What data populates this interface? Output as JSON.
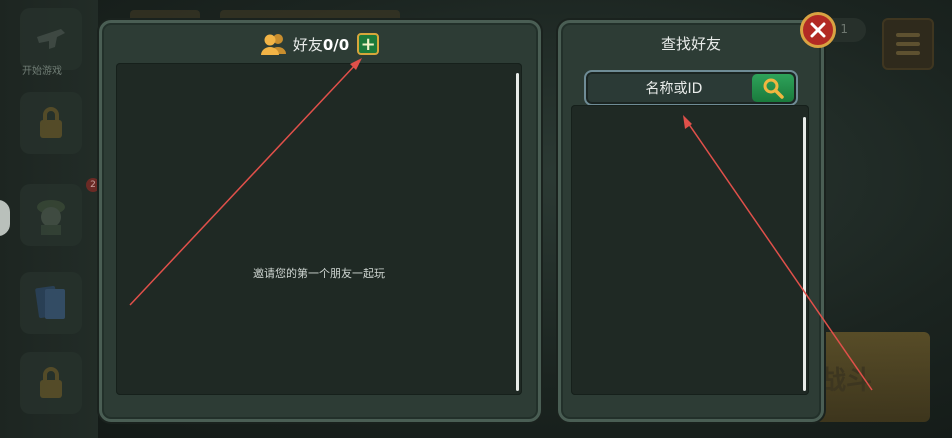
{
  "background": {
    "sidebar_label": "开始游戏",
    "badge": "2",
    "top_right_counter": "1",
    "bottom_right_button_text": "战斗"
  },
  "friends_panel": {
    "title": "好友",
    "count": "0/0",
    "add_label": "+",
    "empty_message": "邀请您的第一个朋友一起玩"
  },
  "search_panel": {
    "title": "查找好友",
    "input_placeholder": "名称或ID",
    "input_value": ""
  },
  "colors": {
    "annotation_arrow": "#e0504a",
    "panel_border": "#4a5e54",
    "add_button": "#1d7a3a",
    "close_button": "#b22a24",
    "gold_trim": "#d9a342"
  },
  "icons": {
    "friends": "people-icon",
    "add": "plus-icon",
    "search": "magnifier-icon",
    "close": "x-icon",
    "menu": "hamburger-icon"
  }
}
